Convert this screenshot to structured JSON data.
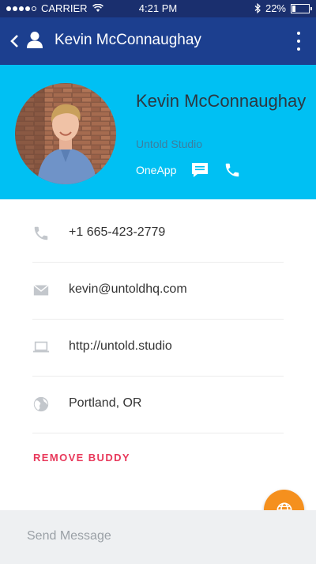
{
  "status_bar": {
    "carrier": "CARRIER",
    "time": "4:21 PM",
    "battery": "22%",
    "battery_level": 0.22
  },
  "nav": {
    "title": "Kevin McConnaughay"
  },
  "profile": {
    "name": "Kevin McConnaughay",
    "company": "Untold Studio",
    "action_label": "OneApp"
  },
  "details": [
    {
      "icon": "phone-icon",
      "value": "+1 665-423-2779"
    },
    {
      "icon": "mail-icon",
      "value": "kevin@untoldhq.com"
    },
    {
      "icon": "laptop-icon",
      "value": "http://untold.studio"
    },
    {
      "icon": "globe-icon",
      "value": "Portland, OR"
    }
  ],
  "remove_button": "REMOVE BUDDY",
  "composer": {
    "placeholder": "Send Message"
  },
  "colors": {
    "status_bar": "#1a2f6e",
    "nav_bar": "#1c3f8f",
    "header": "#00c0f3",
    "accent_red": "#e8385a",
    "fab": "#f5901e"
  }
}
